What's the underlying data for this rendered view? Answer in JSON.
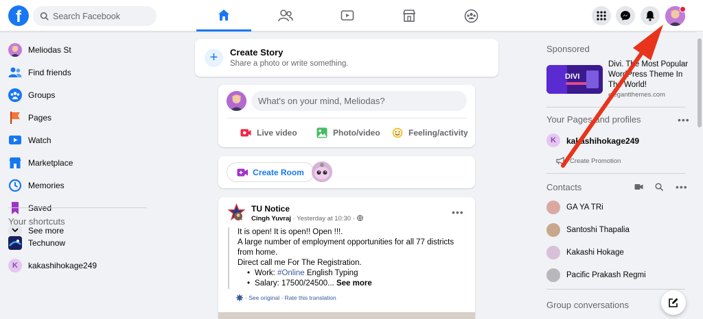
{
  "search": {
    "placeholder": "Search Facebook"
  },
  "nav": {
    "tabs": [
      {
        "name": "home",
        "icon": "home-icon",
        "active": true
      },
      {
        "name": "friends",
        "icon": "friends-icon"
      },
      {
        "name": "watch",
        "icon": "watch-icon"
      },
      {
        "name": "marketplace",
        "icon": "marketplace-icon"
      },
      {
        "name": "groups",
        "icon": "groups-icon"
      }
    ]
  },
  "header_buttons": [
    "menu-grid-icon",
    "messenger-icon",
    "notifications-icon",
    "profile-avatar"
  ],
  "sidebar": {
    "items": [
      {
        "label": "Meliodas St",
        "icon": "avatar"
      },
      {
        "label": "Find friends",
        "icon": "friends-icon",
        "color": "#1877f2"
      },
      {
        "label": "Groups",
        "icon": "groups-icon",
        "color": "#1877f2"
      },
      {
        "label": "Pages",
        "icon": "flag-icon",
        "color": "#f7743b"
      },
      {
        "label": "Watch",
        "icon": "watch-icon",
        "color": "#1877f2"
      },
      {
        "label": "Marketplace",
        "icon": "marketplace-icon",
        "color": "#1877f2"
      },
      {
        "label": "Memories",
        "icon": "clock-icon",
        "color": "#1877f2"
      },
      {
        "label": "Saved",
        "icon": "bookmark-icon",
        "color": "#a033c6"
      },
      {
        "label": "See more",
        "icon": "chevron-down-icon"
      }
    ],
    "shortcuts_title": "Your shortcuts",
    "shortcuts": [
      {
        "label": "Techunow"
      },
      {
        "label": "kakashihokage249",
        "initial": "K"
      }
    ]
  },
  "create_story": {
    "title": "Create Story",
    "subtitle": "Share a photo or write something."
  },
  "composer": {
    "placeholder": "What's on your mind, Meliodas?",
    "actions": [
      {
        "label": "Live video",
        "color": "#f02849"
      },
      {
        "label": "Photo/video",
        "color": "#45bd62"
      },
      {
        "label": "Feeling/activity",
        "color": "#f7b928"
      }
    ]
  },
  "room": {
    "label": "Create Room"
  },
  "post": {
    "author": "TU Notice",
    "meta_author": "Cingh Yuvraj",
    "meta_time": "· Yesterday at 10:30 ·",
    "line1": "It is open! It is open!! Open !!!.",
    "line2": "A large number of employment opportunities for all 77 districts from home.",
    "line3": "Direct call me  For The Registration.",
    "bullet1_prefix": "Work:  ",
    "bullet1_tag": "#Online",
    "bullet1_suffix": " English Typing",
    "bullet2": "Salary: 17500/24500... ",
    "see_more": "See more",
    "foot": "· See original · Rate this translation"
  },
  "right": {
    "sponsored_title": "Sponsored",
    "ad_text": "Divi. The Most Popular WordPress Theme In The World!",
    "ad_site": "elegantthemes.com",
    "ad_logo": "DIVI",
    "pages_title": "Your Pages and profiles",
    "page_initial": "K",
    "page_name": "kakashihokage249",
    "promo_label": "Create Promotion",
    "contacts_title": "Contacts",
    "contacts": [
      {
        "label": "GA YA TRi",
        "color": "#d9a9a0"
      },
      {
        "label": "Santoshi Thapalia",
        "color": "#c8a88c"
      },
      {
        "label": "Kakashi Hokage",
        "color": "#d8c0d8"
      },
      {
        "label": "Pacific Prakash Regmi",
        "color": "#b8b8bc"
      }
    ],
    "groups_title": "Group conversations"
  },
  "colors": {
    "brand": "#1877f2",
    "annotation_arrow": "#e8341c"
  }
}
